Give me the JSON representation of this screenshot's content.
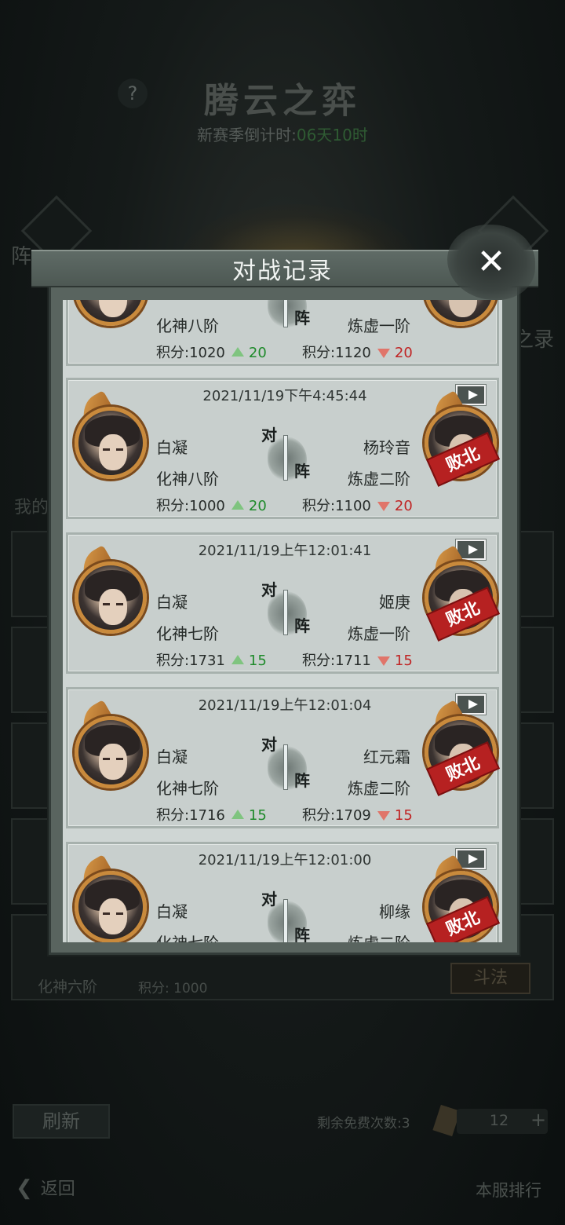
{
  "page": {
    "help_icon_glyph": "?",
    "title": "腾云之弈",
    "season_label": "新赛季倒计时:",
    "season_countdown": "06天10时",
    "side_left_label": "阵",
    "side_right_label": "之录",
    "my_label": "我的",
    "bottom_row": {
      "rank": "化神六阶",
      "score": "积分: 1000",
      "fight_label": "斗法"
    },
    "refresh_label": "刷新",
    "free_count_label": "剩余免费次数:3",
    "ticket_count": "12",
    "ticket_plus": "+",
    "back_label": "返回",
    "rank_list_label": "本服排行"
  },
  "modal": {
    "title": "对战记录",
    "close_glyph": "✕",
    "vs_top": "对",
    "vs_bottom": "阵",
    "lose_label": "败北",
    "records": [
      {
        "time": "",
        "left": {
          "name": "",
          "rank": "化神八阶",
          "score_text": "积分:1020",
          "delta": "20",
          "direction": "up"
        },
        "right": {
          "name": "",
          "rank": "炼虚一阶",
          "score_text": "积分:1120",
          "delta": "20",
          "direction": "down"
        },
        "result": ""
      },
      {
        "time": "2021/11/19下午4:45:44",
        "left": {
          "name": "白凝",
          "rank": "化神八阶",
          "score_text": "积分:1000",
          "delta": "20",
          "direction": "up"
        },
        "right": {
          "name": "杨玲音",
          "rank": "炼虚二阶",
          "score_text": "积分:1100",
          "delta": "20",
          "direction": "down"
        },
        "result": "败北"
      },
      {
        "time": "2021/11/19上午12:01:41",
        "left": {
          "name": "白凝",
          "rank": "化神七阶",
          "score_text": "积分:1731",
          "delta": "15",
          "direction": "up"
        },
        "right": {
          "name": "姬庚",
          "rank": "炼虚一阶",
          "score_text": "积分:1711",
          "delta": "15",
          "direction": "down"
        },
        "result": "败北"
      },
      {
        "time": "2021/11/19上午12:01:04",
        "left": {
          "name": "白凝",
          "rank": "化神七阶",
          "score_text": "积分:1716",
          "delta": "15",
          "direction": "up"
        },
        "right": {
          "name": "红元霜",
          "rank": "炼虚二阶",
          "score_text": "积分:1709",
          "delta": "15",
          "direction": "down"
        },
        "result": "败北"
      },
      {
        "time": "2021/11/19上午12:01:00",
        "left": {
          "name": "白凝",
          "rank": "化神七阶",
          "score_text": "",
          "delta": "",
          "direction": "up"
        },
        "right": {
          "name": "柳缘",
          "rank": "炼虚二阶",
          "score_text": "",
          "delta": "",
          "direction": "down"
        },
        "result": "败北"
      }
    ]
  },
  "colors": {
    "win_delta": "#1e8a2a",
    "lose_delta": "#c02424",
    "lose_stamp": "#b62121",
    "avatar_ring": "#c98a3c"
  }
}
